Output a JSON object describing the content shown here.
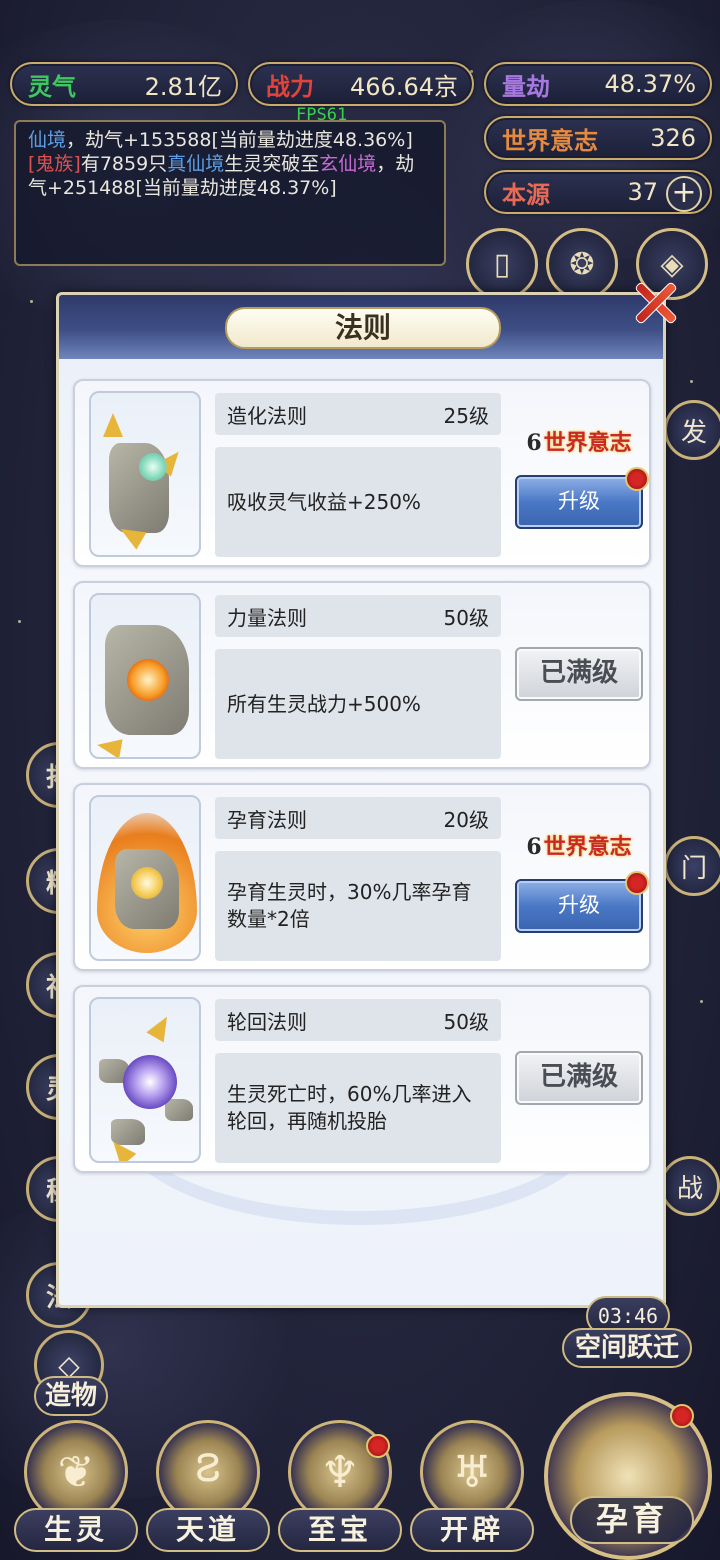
{
  "fps": "FPS61",
  "top_stats": {
    "lingqi": {
      "label": "灵气",
      "value": "2.81亿",
      "color": "#3fc85f"
    },
    "zhanli": {
      "label": "战力",
      "value": "466.64京",
      "color": "#e3433a"
    },
    "liangjie": {
      "label": "量劫",
      "value": "48.37%",
      "color": "#a779e0"
    },
    "shijie_yizhi": {
      "label": "世界意志",
      "value": "326",
      "color": "#e58a3f"
    },
    "benyuan": {
      "label": "本源",
      "value": "37",
      "color": "#e86a55"
    }
  },
  "log": {
    "line1_prefix": "仙境",
    "line1_rest": "，劫气+153588[当前量劫进度48.36%]",
    "line2_race": "[鬼族]",
    "line2_mid1": "有7859只",
    "line2_realm1": "真仙境",
    "line2_mid2": "生灵突破至",
    "line2_realm2": "玄仙境",
    "line2_rest": "，劫气+251488[当前量劫进度48.37%]"
  },
  "side_partial_labels": {
    "right_top": "发",
    "right_mid": "门",
    "right_low": "战",
    "time": "03:46",
    "space_jump": "空间跃迁",
    "left_1": "拓",
    "left_2": "精",
    "left_3": "神",
    "left_4": "灵",
    "left_5": "秘",
    "left_6": "法",
    "zaowu": "造物"
  },
  "dialog": {
    "title": "法则",
    "laws": [
      {
        "name": "造化法则",
        "level": "25级",
        "desc": "吸收灵气收益+250%",
        "cost_num": "6",
        "cost_unit": "世界意志",
        "action": "升级",
        "maxed": false
      },
      {
        "name": "力量法则",
        "level": "50级",
        "desc": "所有生灵战力+500%",
        "action": "已满级",
        "maxed": true
      },
      {
        "name": "孕育法则",
        "level": "20级",
        "desc": "孕育生灵时，30%几率孕育数量*2倍",
        "cost_num": "6",
        "cost_unit": "世界意志",
        "action": "升级",
        "maxed": false
      },
      {
        "name": "轮回法则",
        "level": "50级",
        "desc": "生灵死亡时，60%几率进入轮回，再随机投胎",
        "action": "已满级",
        "maxed": true
      }
    ]
  },
  "bottom_nav": {
    "shengling": "生灵",
    "tiandao": "天道",
    "zhibao": "至宝",
    "kaipi": "开辟",
    "yunyu": "孕育"
  }
}
